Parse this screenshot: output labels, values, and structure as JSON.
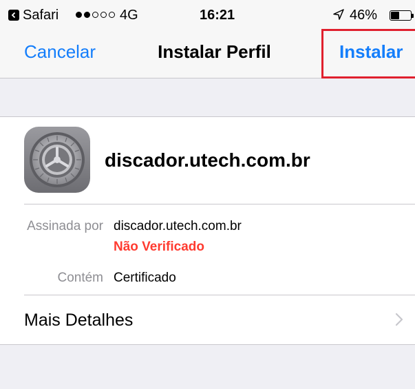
{
  "status_bar": {
    "carrier": "Safari",
    "signal_bars_filled": 2,
    "signal_bars_total": 5,
    "network": "4G",
    "time": "16:21",
    "battery_percent": "46%",
    "battery_level": 0.46
  },
  "nav": {
    "cancel_label": "Cancelar",
    "title": "Instalar Perfil",
    "install_label": "Instalar"
  },
  "profile": {
    "name": "discador.utech.com.br",
    "icon": "settings-gear-icon"
  },
  "details": {
    "signed_by_label": "Assinada por",
    "signed_by_value": "discador.utech.com.br",
    "verification_status": "Não Verificado",
    "contains_label": "Contém",
    "contains_value": "Certificado"
  },
  "more_details_label": "Mais Detalhes",
  "colors": {
    "accent": "#147efb",
    "warning": "#ff3b30",
    "highlight": "#e0202e",
    "grouped_bg": "#efeff4",
    "secondary_text": "#8e8e93"
  }
}
